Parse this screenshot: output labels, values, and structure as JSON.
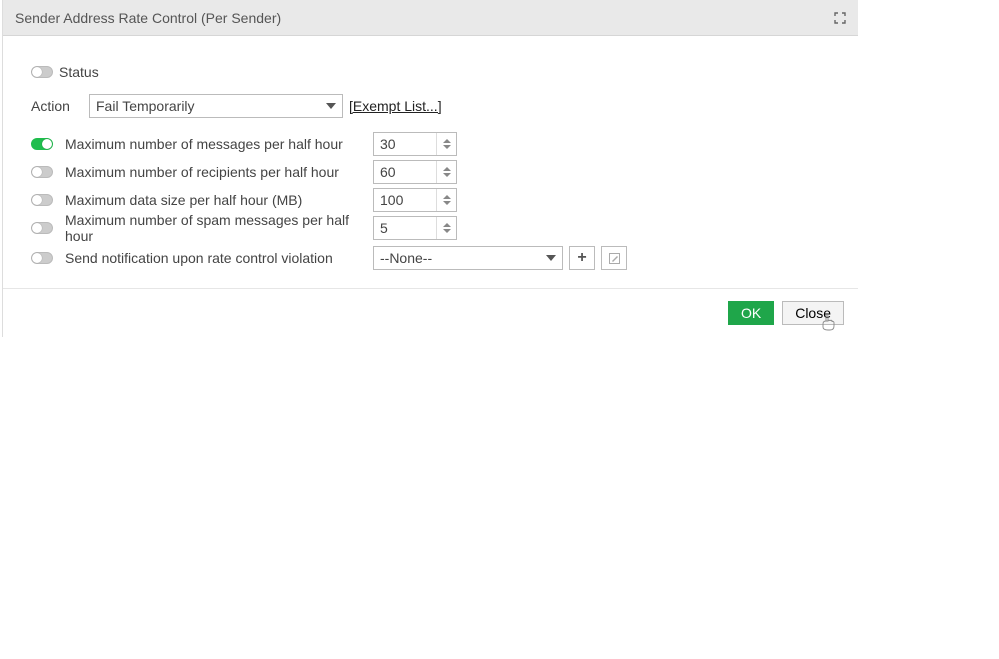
{
  "header": {
    "title": "Sender Address Rate Control (Per Sender)"
  },
  "status": {
    "label": "Status",
    "enabled": false
  },
  "action": {
    "label": "Action",
    "selected": "Fail Temporarily",
    "exempt_link": "[Exempt List...]"
  },
  "settings": [
    {
      "key": "max_messages",
      "enabled": true,
      "label": "Maximum number of messages per half hour",
      "value": "30"
    },
    {
      "key": "max_recipients",
      "enabled": false,
      "label": "Maximum number of recipients per half hour",
      "value": "60"
    },
    {
      "key": "max_data_size",
      "enabled": false,
      "label": "Maximum data size per half hour (MB)",
      "value": "100"
    },
    {
      "key": "max_spam",
      "enabled": false,
      "label": "Maximum number of spam messages per half hour",
      "value": "5"
    }
  ],
  "notify": {
    "enabled": false,
    "label": "Send notification upon rate control violation",
    "selected": "--None--"
  },
  "footer": {
    "ok": "OK",
    "close": "Close"
  }
}
